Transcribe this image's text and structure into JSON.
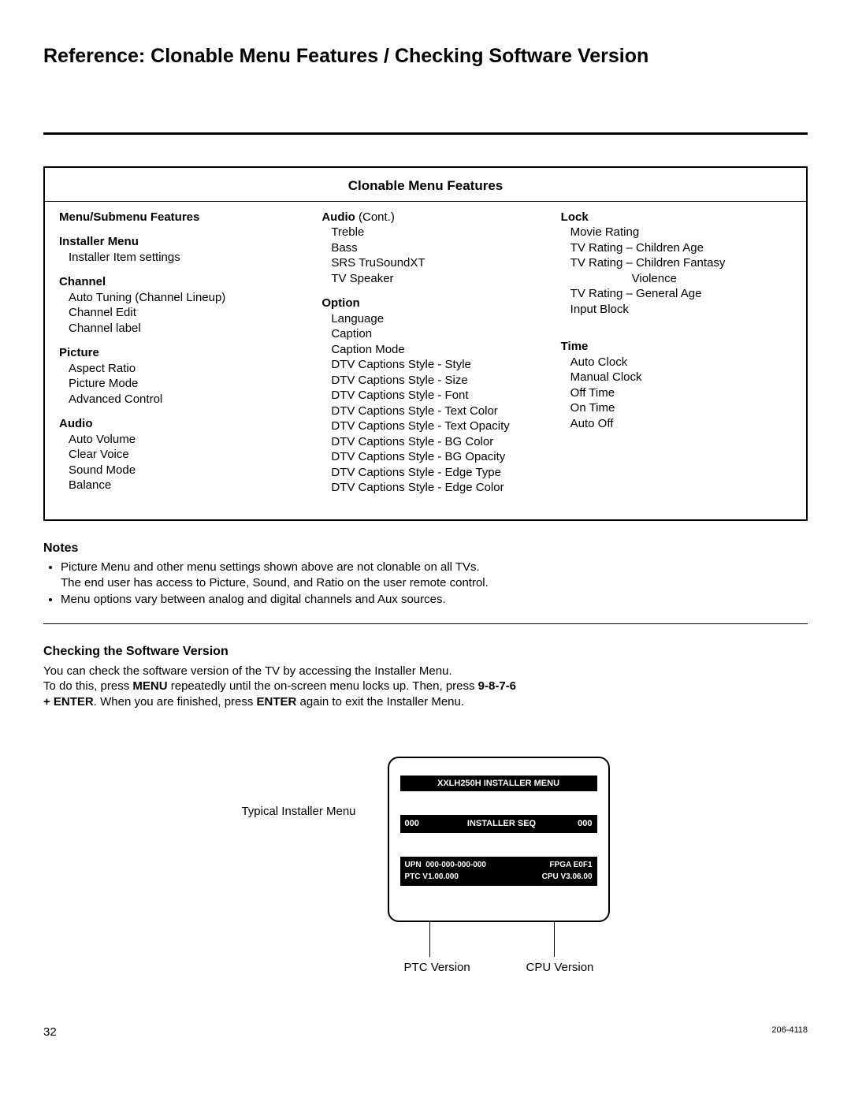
{
  "page_title": "Reference: Clonable Menu Features / Checking Software Version",
  "box_title": "Clonable Menu Features",
  "col1_header": "Menu/Submenu Features",
  "groups": {
    "installer": {
      "title": "Installer Menu",
      "items": [
        "Installer Item settings"
      ]
    },
    "channel": {
      "title": "Channel",
      "items": [
        "Auto Tuning (Channel Lineup)",
        "Channel Edit",
        "Channel label"
      ]
    },
    "picture": {
      "title": "Picture",
      "items": [
        "Aspect Ratio",
        "Picture Mode",
        "Advanced Control"
      ]
    },
    "audio": {
      "title": "Audio",
      "items": [
        "Auto Volume",
        "Clear Voice",
        "Sound Mode",
        "Balance"
      ]
    },
    "audio2": {
      "title_bold": "Audio",
      "title_rest": " (Cont.)",
      "items": [
        "Treble",
        "Bass",
        "SRS TruSoundXT",
        "TV Speaker"
      ]
    },
    "option": {
      "title": "Option",
      "items": [
        "Language",
        "Caption",
        "Caption Mode",
        "DTV Captions Style - Style",
        "DTV Captions Style - Size",
        "DTV Captions Style - Font",
        "DTV Captions Style - Text Color",
        "DTV Captions Style - Text Opacity",
        "DTV Captions Style - BG Color",
        "DTV Captions Style - BG Opacity",
        "DTV Captions Style - Edge Type",
        "DTV Captions Style - Edge Color"
      ]
    },
    "lock": {
      "title": "Lock",
      "items": [
        "Movie Rating",
        "TV Rating – Children Age",
        "TV Rating – Children Fantasy",
        "Violence",
        "TV Rating – General Age",
        "Input Block"
      ]
    },
    "time": {
      "title": "Time",
      "items": [
        "Auto Clock",
        "Manual Clock",
        "Off Time",
        "On Time",
        "Auto Off"
      ]
    }
  },
  "notes_title": "Notes",
  "notes": {
    "n1a": "Picture Menu and other menu settings shown above are not clonable on all TVs.",
    "n1b": "The end user has access to Picture, Sound, and Ratio on the user remote control.",
    "n2": "Menu options vary between analog and digital channels and Aux sources."
  },
  "sv_title": "Checking the Software Version",
  "sv": {
    "l1": "You can check the software version of the TV by accessing the Installer Menu.",
    "l2_a": "To do this, press ",
    "l2_b": "MENU",
    "l2_c": " repeatedly until the on-screen menu locks up. Then, press ",
    "l2_d": "9-8-7-6",
    "l3_a": "+ ENTER",
    "l3_b": ". When you are finished, press ",
    "l3_c": "ENTER",
    "l3_d": " again to exit the Installer Menu."
  },
  "installer_label": "Typical Installer Menu",
  "panel": {
    "title": "XXLH250H INSTALLER MENU",
    "row_left": "000",
    "row_mid": "INSTALLER SEQ",
    "row_right": "000",
    "upn_label": "UPN",
    "upn_val": "000-000-000-000",
    "fpga": "FPGA E0F1",
    "ptc": "PTC V1.00.000",
    "cpu": "CPU V3.06.00"
  },
  "version_labels": {
    "ptc": "PTC Version",
    "cpu": "CPU Version"
  },
  "footer": {
    "page": "32",
    "doc": "206-4118"
  }
}
